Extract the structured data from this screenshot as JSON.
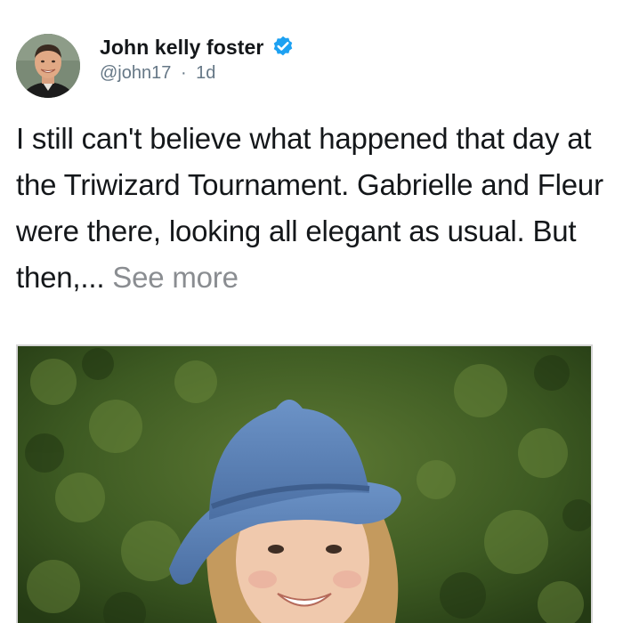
{
  "author": {
    "display_name": "John kelly foster",
    "handle": "@john17",
    "separator": "·",
    "timestamp": "1d",
    "verified": true
  },
  "tweet": {
    "text": "I still can't believe what happened that day at the Triwizard Tournament. Gabrielle and Fleur were there, looking all elegant as usual. But then,...",
    "see_more": "See more"
  },
  "icons": {
    "verified": "verified-badge-icon",
    "avatar": "profile-photo"
  },
  "colors": {
    "verified_blue": "#1da1f2",
    "handle_gray": "#657786",
    "see_more_gray": "#8a8d91",
    "text": "#14171a"
  }
}
